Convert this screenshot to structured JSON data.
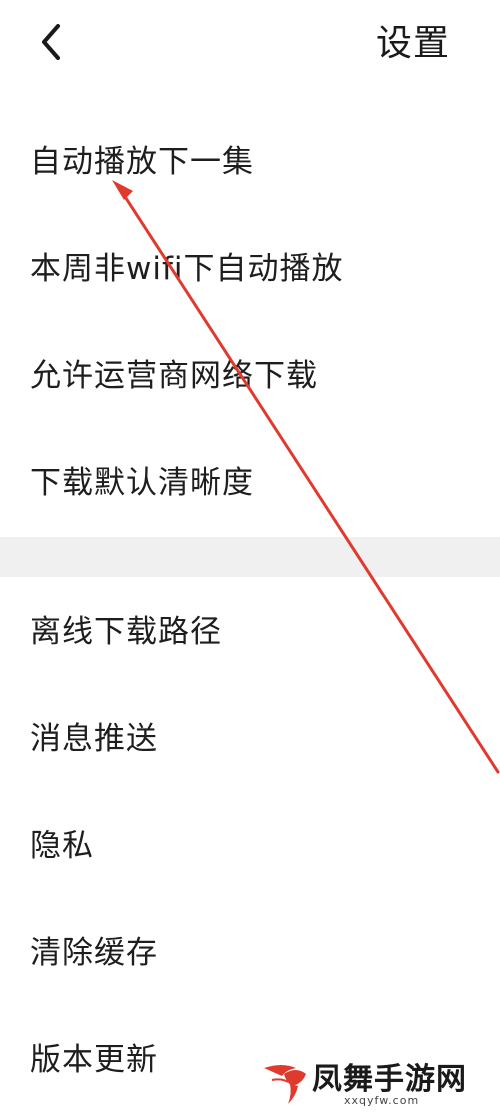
{
  "header": {
    "back_icon": "chevron-left-icon",
    "title": "设置"
  },
  "settings_group_1": {
    "items": [
      {
        "label": "自动播放下一集"
      },
      {
        "label": "本周非wifi下自动播放"
      },
      {
        "label": "允许运营商网络下载"
      },
      {
        "label": "下载默认清晰度"
      }
    ]
  },
  "settings_group_2": {
    "items": [
      {
        "label": "离线下载路径"
      },
      {
        "label": "消息推送"
      },
      {
        "label": "隐私"
      },
      {
        "label": "清除缓存"
      },
      {
        "label": "版本更新"
      }
    ]
  },
  "annotation": {
    "type": "arrow",
    "color": "#e03a2f",
    "points_to": "自动播放下一集"
  },
  "watermark": {
    "name": "凤舞手游网",
    "url": "xxqyfw.com",
    "logo_icon": "bird-logo-icon",
    "accent_color": "#e03a2f"
  },
  "colors": {
    "background": "#ffffff",
    "text": "#1e1e1e",
    "separator": "#f0f0f0"
  }
}
